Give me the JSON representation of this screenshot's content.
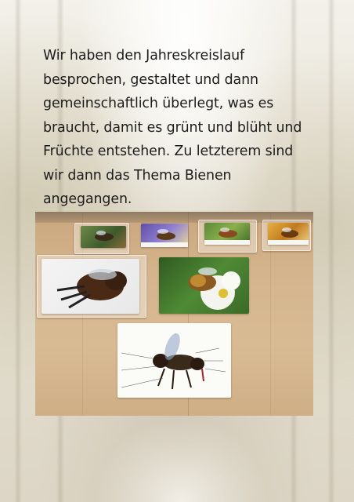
{
  "text": {
    "lines": [
      "Wir haben den Jahreskreislauf",
      "besprochen, gestaltet und dann",
      "gemeinschaftlich überlegt, was es",
      "braucht, damit es grünt und blüht und",
      "Früchte entstehen. Zu letzterem sind",
      "wir dann das Thema Bienen",
      "angegangen."
    ]
  },
  "photo": {
    "subject": "Bienen-Bildkarten auf einem Holztisch"
  },
  "colors": {
    "text": "#1c1c1c",
    "table": "#d4b48c"
  }
}
